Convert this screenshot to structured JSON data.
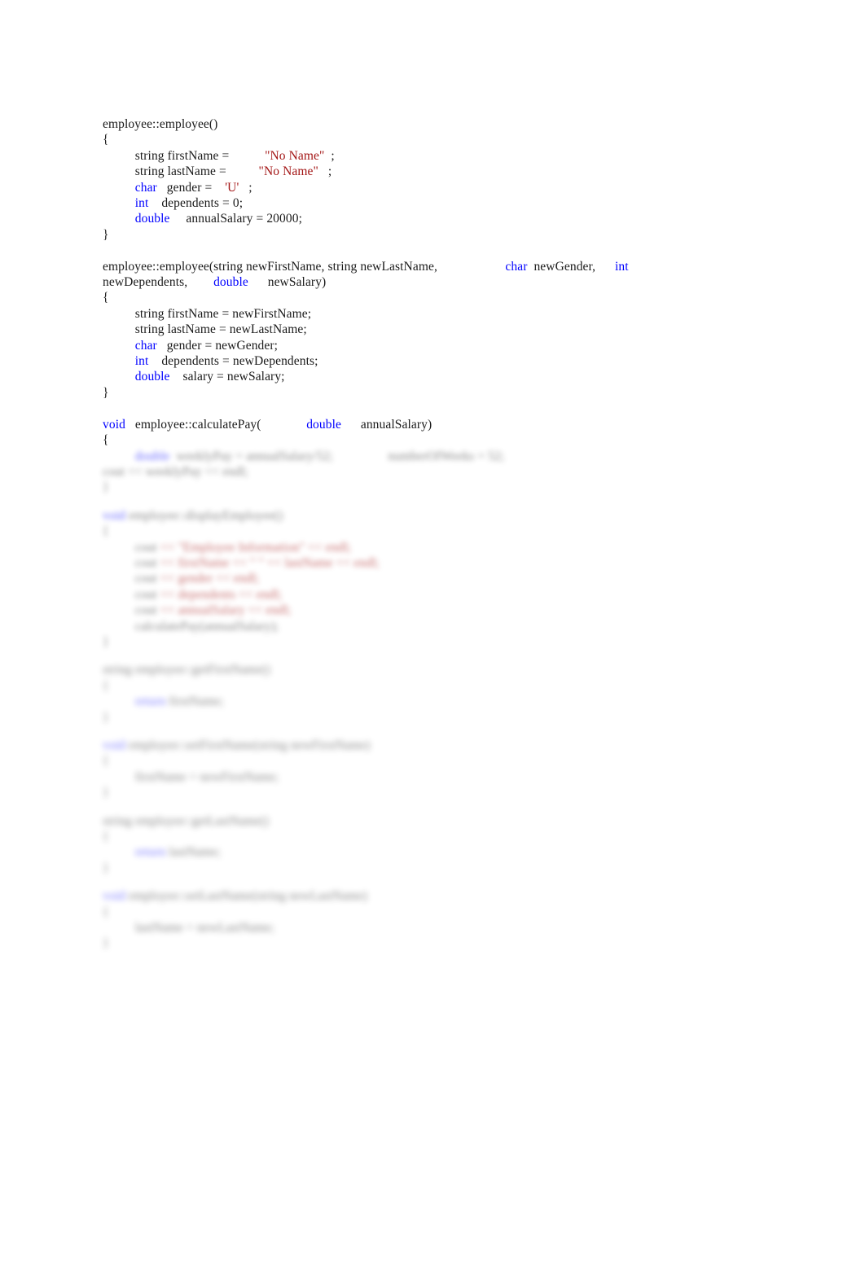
{
  "document": {
    "type": "source-code-listing",
    "language": "C++",
    "background_color": "#ffffff",
    "text_color": "#1a1a1a",
    "keyword_color": "#0000ff",
    "string_color": "#a31515",
    "legible_region": "top portion",
    "blurred_region": "lower portion is out of focus and illegible"
  },
  "code": {
    "default_constructor": {
      "signature": "employee::employee()",
      "open_brace": "{",
      "close_brace": "}",
      "lines": [
        {
          "indent": "\t",
          "plain_before": "string firstName = ",
          "tab": "\t\t",
          "string_literal": "\"No Name\"",
          "plain_after": "  ;"
        },
        {
          "indent": "\t",
          "plain_before": "string lastName = ",
          "tab": "\t\t",
          "string_literal": "\"No Name\"",
          "plain_after": "   ;"
        },
        {
          "indent": "\t",
          "keyword": "char",
          "plain_before": "   gender = ",
          "tab": "     ",
          "string_literal": "'U'",
          "plain_after": "   ;"
        },
        {
          "indent": "\t",
          "keyword": "int",
          "plain_before": "    dependents = 0;",
          "tab": "",
          "string_literal": "",
          "plain_after": ""
        },
        {
          "indent": "\t",
          "keyword": "double",
          "plain_before": "     annualSalary = 20000;",
          "tab": "",
          "string_literal": "",
          "plain_after": ""
        }
      ]
    },
    "param_constructor": {
      "signature_part1": "employee::employee(string newFirstName, string newLastName, ",
      "signature_kw1": "char",
      "signature_part2": "  newGender,      ",
      "signature_kw2": "int",
      "signature_line2_part1": "newDependents,        ",
      "signature_line2_kw": "double",
      "signature_line2_part2": "      newSalary)",
      "open_brace": "{",
      "close_brace": "}",
      "lines": [
        {
          "indent": "\t",
          "keyword": "",
          "text": "string firstName = newFirstName;"
        },
        {
          "indent": "\t",
          "keyword": "",
          "text": "string lastName = newLastName;"
        },
        {
          "indent": "\t",
          "keyword": "char",
          "text": "   gender = newGender;"
        },
        {
          "indent": "\t",
          "keyword": "int",
          "text": "    dependents = newDependents;"
        },
        {
          "indent": "\t",
          "keyword": "double",
          "text": "    salary = newSalary;"
        }
      ]
    },
    "calculate_pay": {
      "signature_kw1": "void",
      "signature_part1": "   employee::calculatePay(              ",
      "signature_kw2": "double",
      "signature_part2": "      annualSalary)",
      "open_brace": "{"
    },
    "blurred_blocks": [
      {
        "lines": [
          {
            "indent": "\t",
            "kw": "double",
            "rest": "  weeklyPay = annualSalary/52;",
            "right": "numberOfWeeks = 52;"
          },
          {
            "indent": "",
            "kw": "",
            "rest": "cout << weeklyPay << endl;",
            "right": ""
          },
          {
            "indent": "",
            "kw": "",
            "rest": "}",
            "right": ""
          }
        ]
      },
      {
        "lines": [
          {
            "indent": "",
            "kw": "void",
            "rest": " employee::displayEmployee()",
            "right": ""
          },
          {
            "indent": "",
            "kw": "",
            "rest": "{",
            "right": ""
          },
          {
            "indent": "\t",
            "kw": "cout",
            "rest": " << \"Employee Information\" << endl;",
            "right": ""
          },
          {
            "indent": "\t",
            "kw": "cout",
            "rest": " << firstName << \" \" << lastName << endl;",
            "right": ""
          },
          {
            "indent": "\t",
            "kw": "cout",
            "rest": " << gender << endl;",
            "right": ""
          },
          {
            "indent": "\t",
            "kw": "cout",
            "rest": " << dependents << endl;",
            "right": ""
          },
          {
            "indent": "\t",
            "kw": "cout",
            "rest": " << annualSalary << endl;",
            "right": ""
          },
          {
            "indent": "",
            "kw": "",
            "rest": "calculatePay(annualSalary);",
            "right": ""
          },
          {
            "indent": "",
            "kw": "",
            "rest": "}",
            "right": ""
          }
        ]
      },
      {
        "lines": [
          {
            "indent": "",
            "kw": "",
            "rest": "string employee::getFirstName()",
            "right": ""
          },
          {
            "indent": "",
            "kw": "",
            "rest": "{",
            "right": ""
          },
          {
            "indent": "\t",
            "kw": "return",
            "rest": " firstName;",
            "right": ""
          },
          {
            "indent": "",
            "kw": "",
            "rest": "}",
            "right": ""
          }
        ]
      },
      {
        "lines": [
          {
            "indent": "",
            "kw": "void",
            "rest": " employee::setFirstName(string newFirstName)",
            "right": ""
          },
          {
            "indent": "",
            "kw": "",
            "rest": "{",
            "right": ""
          },
          {
            "indent": "\t",
            "kw": "",
            "rest": "firstName = newFirstName;",
            "right": ""
          },
          {
            "indent": "",
            "kw": "",
            "rest": "}",
            "right": ""
          }
        ]
      },
      {
        "lines": [
          {
            "indent": "",
            "kw": "",
            "rest": "string employee::getLastName()",
            "right": ""
          },
          {
            "indent": "",
            "kw": "",
            "rest": "{",
            "right": ""
          },
          {
            "indent": "\t",
            "kw": "return",
            "rest": " lastName;",
            "right": ""
          },
          {
            "indent": "",
            "kw": "",
            "rest": "}",
            "right": ""
          }
        ]
      },
      {
        "lines": [
          {
            "indent": "",
            "kw": "void",
            "rest": " employee::setLastName(string newLastName)",
            "right": ""
          },
          {
            "indent": "",
            "kw": "",
            "rest": "{",
            "right": ""
          },
          {
            "indent": "\t",
            "kw": "",
            "rest": "lastName = newLastName;",
            "right": ""
          },
          {
            "indent": "",
            "kw": "",
            "rest": "}",
            "right": ""
          }
        ]
      }
    ]
  }
}
